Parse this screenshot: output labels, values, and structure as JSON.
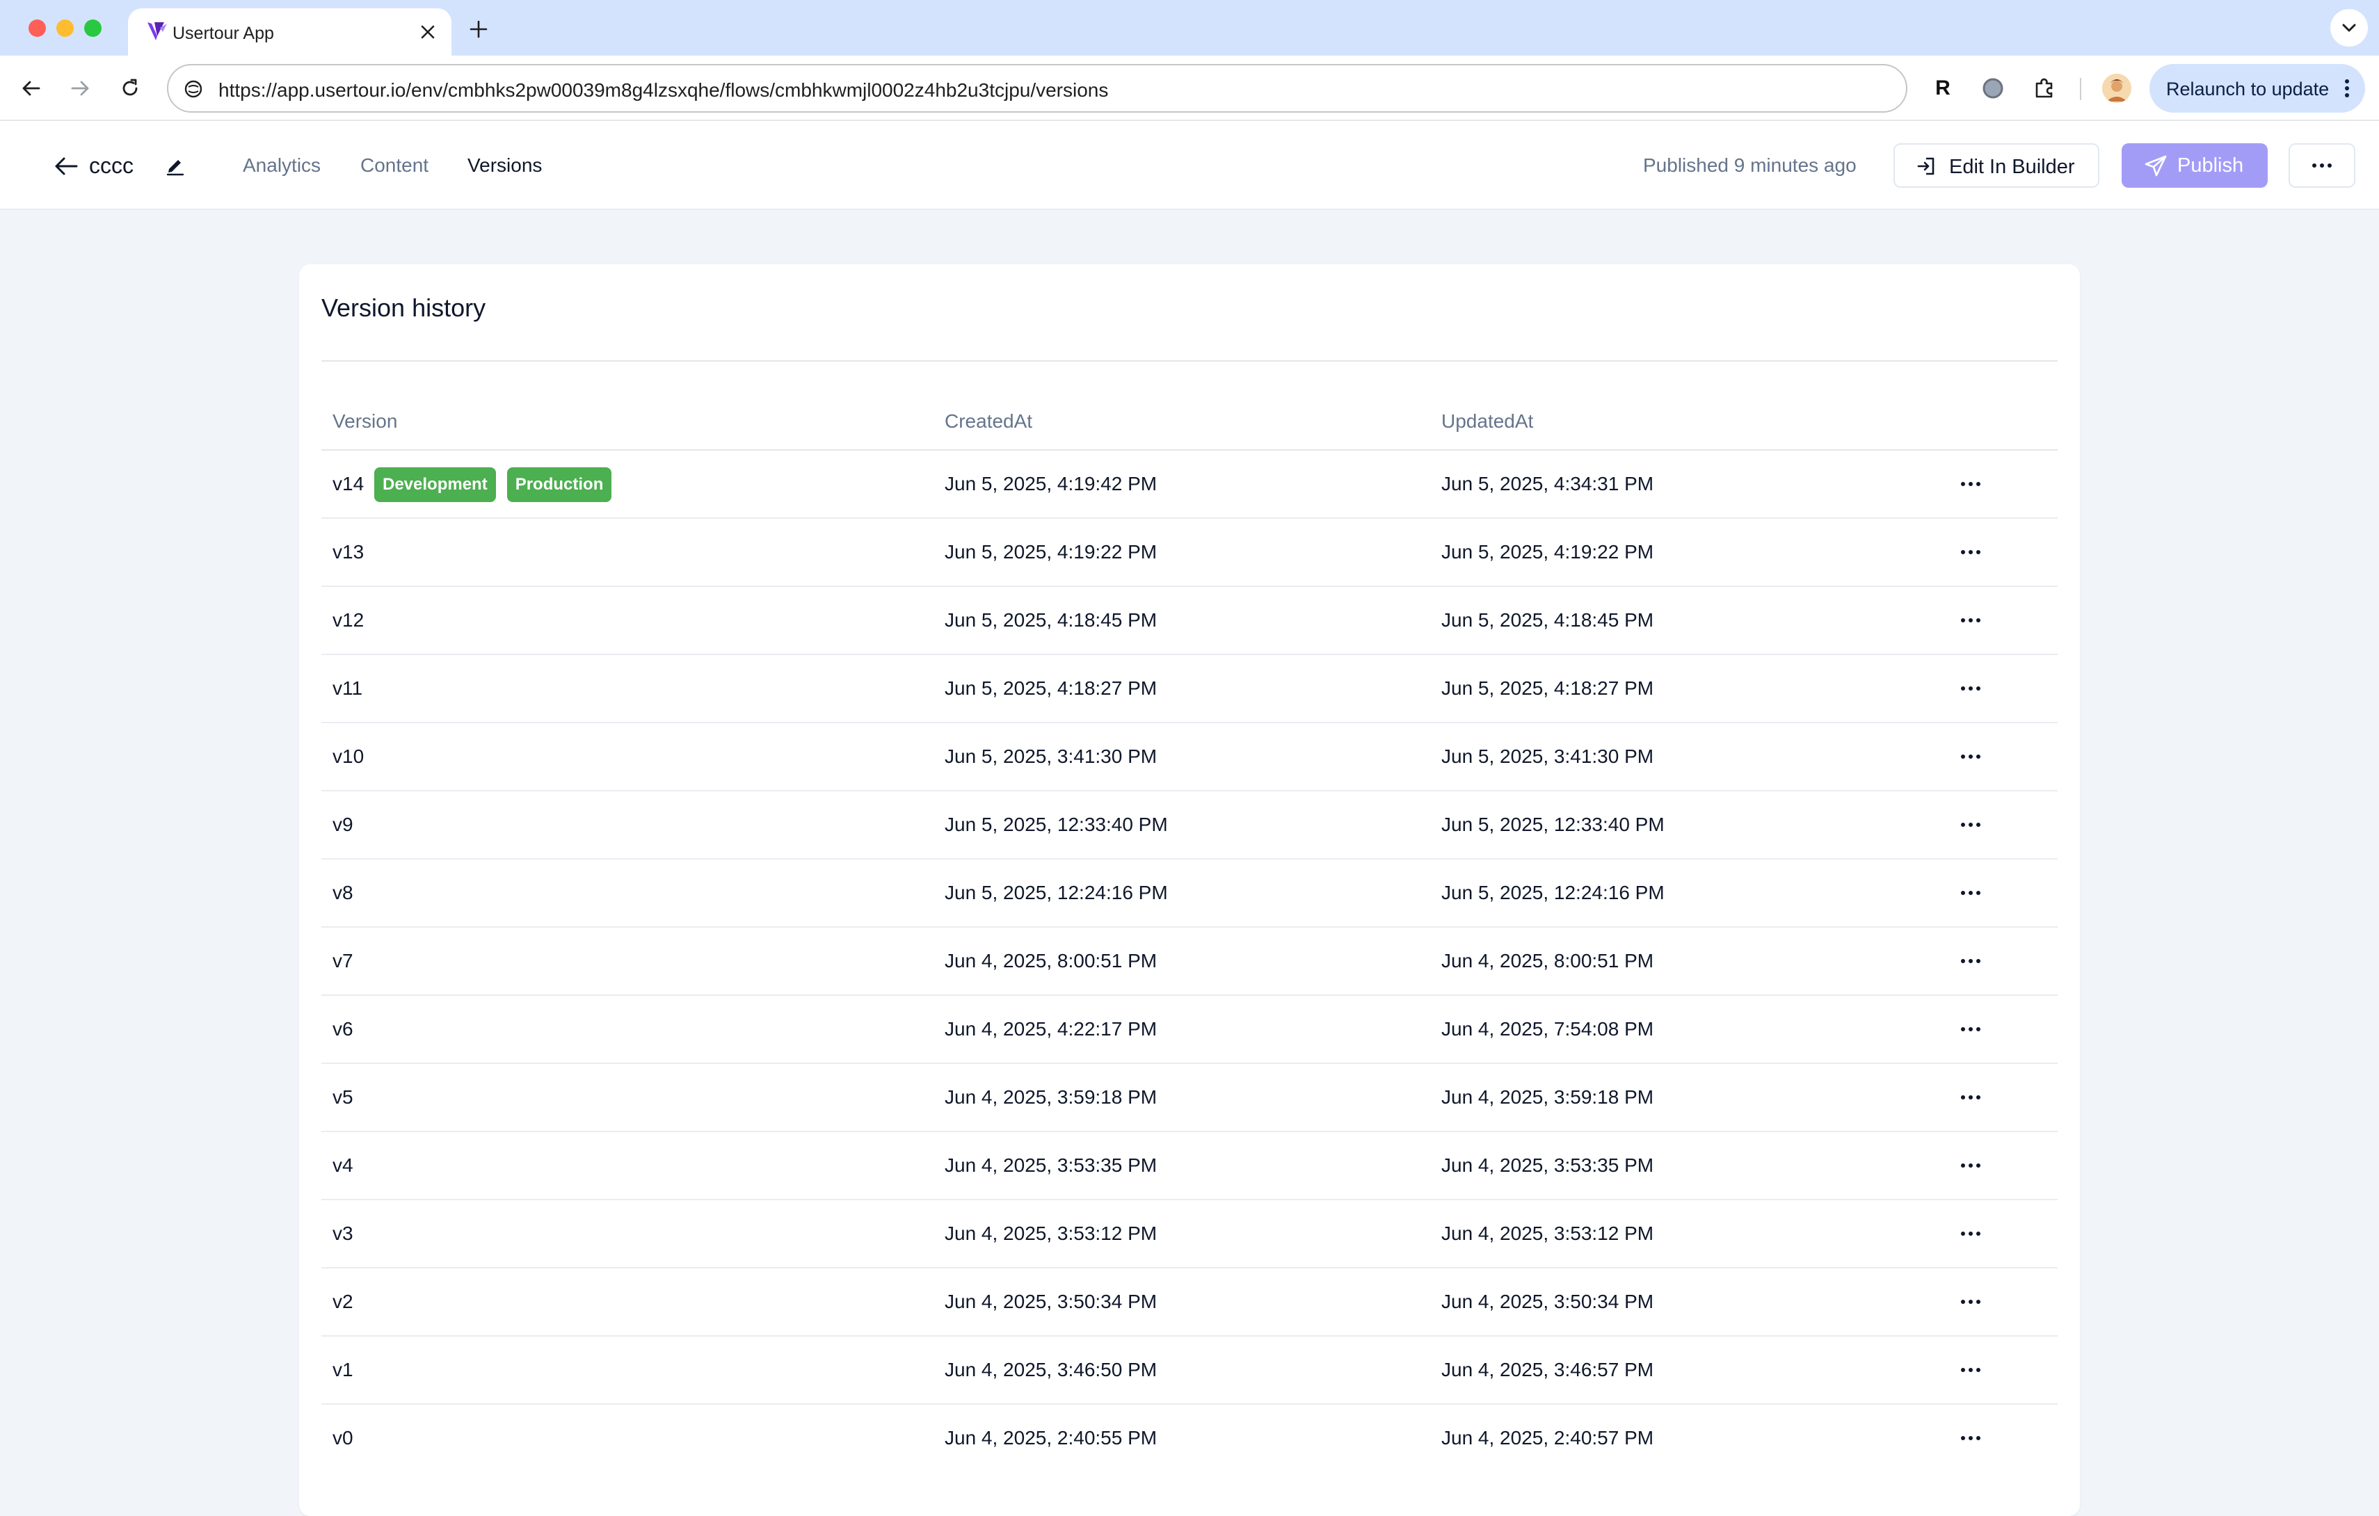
{
  "browser": {
    "tab_title": "Usertour App",
    "url": "https://app.usertour.io/env/cmbhks2pw00039m8g4lzsxqhe/flows/cmbhkwmjl0002z4hb2u3tcjpu/versions",
    "extension_r_label": "R",
    "relaunch_label": "Relaunch to update"
  },
  "header": {
    "flow_name": "cccc",
    "nav": [
      {
        "label": "Analytics"
      },
      {
        "label": "Content"
      },
      {
        "label": "Versions"
      }
    ],
    "published_status": "Published 9 minutes ago",
    "edit_in_builder_label": "Edit In Builder",
    "publish_label": "Publish"
  },
  "card": {
    "title": "Version history",
    "columns": [
      "Version",
      "CreatedAt",
      "UpdatedAt"
    ],
    "badges": [
      "Development",
      "Production"
    ],
    "rows": [
      {
        "version": "v14",
        "created": "Jun 5, 2025, 4:19:42 PM",
        "updated": "Jun 5, 2025, 4:34:31 PM"
      },
      {
        "version": "v13",
        "created": "Jun 5, 2025, 4:19:22 PM",
        "updated": "Jun 5, 2025, 4:19:22 PM"
      },
      {
        "version": "v12",
        "created": "Jun 5, 2025, 4:18:45 PM",
        "updated": "Jun 5, 2025, 4:18:45 PM"
      },
      {
        "version": "v11",
        "created": "Jun 5, 2025, 4:18:27 PM",
        "updated": "Jun 5, 2025, 4:18:27 PM"
      },
      {
        "version": "v10",
        "created": "Jun 5, 2025, 3:41:30 PM",
        "updated": "Jun 5, 2025, 3:41:30 PM"
      },
      {
        "version": "v9",
        "created": "Jun 5, 2025, 12:33:40 PM",
        "updated": "Jun 5, 2025, 12:33:40 PM"
      },
      {
        "version": "v8",
        "created": "Jun 5, 2025, 12:24:16 PM",
        "updated": "Jun 5, 2025, 12:24:16 PM"
      },
      {
        "version": "v7",
        "created": "Jun 4, 2025, 8:00:51 PM",
        "updated": "Jun 4, 2025, 8:00:51 PM"
      },
      {
        "version": "v6",
        "created": "Jun 4, 2025, 4:22:17 PM",
        "updated": "Jun 4, 2025, 7:54:08 PM"
      },
      {
        "version": "v5",
        "created": "Jun 4, 2025, 3:59:18 PM",
        "updated": "Jun 4, 2025, 3:59:18 PM"
      },
      {
        "version": "v4",
        "created": "Jun 4, 2025, 3:53:35 PM",
        "updated": "Jun 4, 2025, 3:53:35 PM"
      },
      {
        "version": "v3",
        "created": "Jun 4, 2025, 3:53:12 PM",
        "updated": "Jun 4, 2025, 3:53:12 PM"
      },
      {
        "version": "v2",
        "created": "Jun 4, 2025, 3:50:34 PM",
        "updated": "Jun 4, 2025, 3:50:34 PM"
      },
      {
        "version": "v1",
        "created": "Jun 4, 2025, 3:46:50 PM",
        "updated": "Jun 4, 2025, 3:46:57 PM"
      },
      {
        "version": "v0",
        "created": "Jun 4, 2025, 2:40:55 PM",
        "updated": "Jun 4, 2025, 2:40:57 PM"
      }
    ]
  },
  "colors": {
    "accent_purple": "#a39cf7",
    "badge_green": "#4caf50",
    "page_background": "#f1f4f9",
    "chrome_blue": "#d3e3fd"
  },
  "icons": {
    "favicon": "usertour-logo-icon",
    "back": "arrow-left-icon",
    "edit": "pencil-icon",
    "builder": "sign-in-icon",
    "publish": "paper-plane-icon",
    "row_menu": "ellipsis-icon"
  }
}
